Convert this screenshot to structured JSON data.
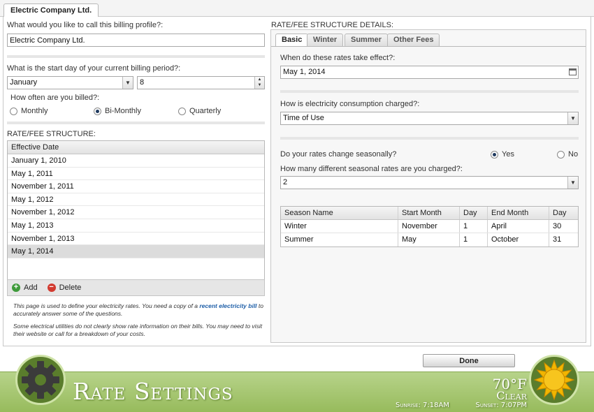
{
  "window": {
    "tab_title": "Electric Company Ltd."
  },
  "left": {
    "profile_question": "What would you like to call this billing profile?:",
    "profile_value": "Electric Company Ltd.",
    "start_day_question": "What is the start day of your current billing period?:",
    "start_month": "January",
    "start_day": "8",
    "billed_question": "How often are you billed?:",
    "billing_options": [
      {
        "label": "Monthly",
        "selected": false
      },
      {
        "label": "Bi-Monthly",
        "selected": true
      },
      {
        "label": "Quarterly",
        "selected": false
      }
    ],
    "rate_section": "RATE/FEE STRUCTURE:",
    "list_header": "Effective Date",
    "dates": [
      "January 1, 2010",
      "May 1, 2011",
      "November 1, 2011",
      "May 1, 2012",
      "November 1, 2012",
      "May 1, 2013",
      "November 1, 2013",
      "May 1, 2014"
    ],
    "selected_date_index": 7,
    "add_label": "Add",
    "delete_label": "Delete",
    "note1_pre": "This page is used to define your electricity rates. You need a copy of a ",
    "note1_link": "recent electricity bill",
    "note1_post": " to accurately answer some of the questions.",
    "note2": "Some electrical utilities do not clearly show rate information on their bills. You may need to visit their website or call for a breakdown of your costs."
  },
  "right": {
    "section": "RATE/FEE STRUCTURE DETAILS:",
    "tabs": [
      "Basic",
      "Winter",
      "Summer",
      "Other Fees"
    ],
    "effect_question": "When do these rates take effect?:",
    "effect_date": "May 1, 2014",
    "consumption_question": "How is electricity consumption charged?:",
    "consumption_value": "Time of Use",
    "seasonal_question": "Do your rates change seasonally?",
    "yes_label": "Yes",
    "no_label": "No",
    "seasonal_selected": "Yes",
    "count_question": "How many different seasonal rates are you charged?:",
    "count_value": "2",
    "season_headers": [
      "Season Name",
      "Start Month",
      "Day",
      "End Month",
      "Day"
    ],
    "seasons": [
      [
        "Winter",
        "November",
        "1",
        "April",
        "30"
      ],
      [
        "Summer",
        "May",
        "1",
        "October",
        "31"
      ]
    ]
  },
  "done_label": "Done",
  "footer": {
    "title": "Rate Settings",
    "temperature": "70°F",
    "condition": "Clear",
    "sunrise": "Sunrise: 7:18AM",
    "sunset": "Sunset: 7:07PM",
    "colors": {
      "bar": "#a6c672",
      "circle": "#5a7d2c",
      "sun": "#f0b400"
    }
  },
  "icons": {
    "gear": "gear-icon",
    "sun": "sun-icon",
    "add": "add-icon",
    "delete": "delete-icon"
  }
}
